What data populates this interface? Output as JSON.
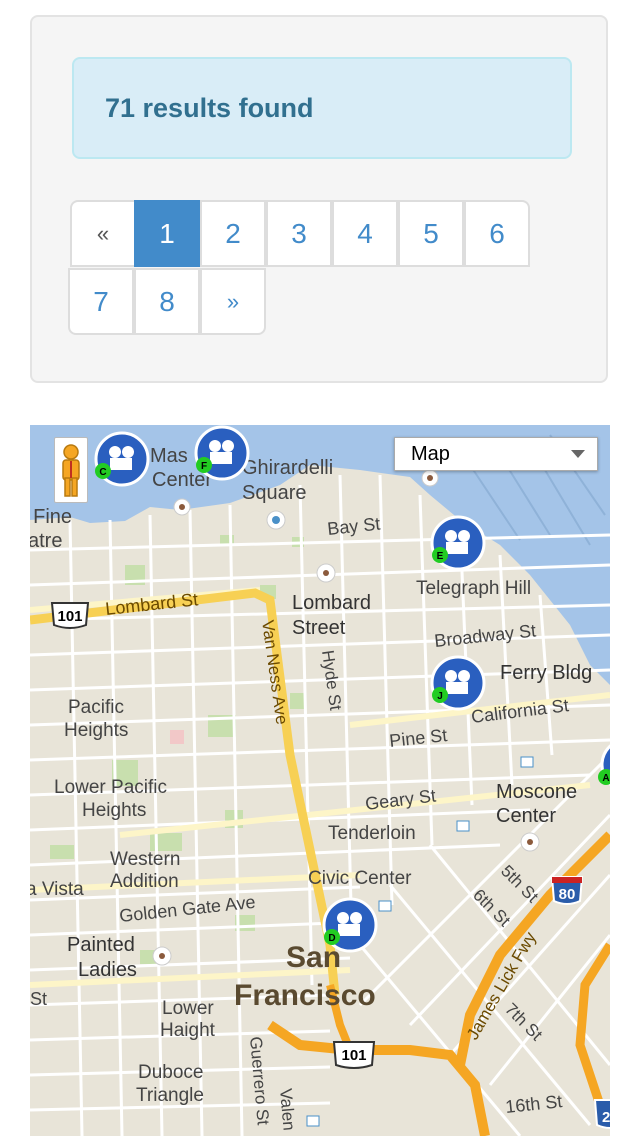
{
  "results": {
    "text": "71 results found"
  },
  "pagination": {
    "prev": "«",
    "next": "»",
    "pages": [
      "1",
      "2",
      "3",
      "4",
      "5",
      "6",
      "7",
      "8"
    ],
    "active": "1"
  },
  "map": {
    "type_selector": "Map",
    "labels": {
      "masonic_center_1": "Mas",
      "masonic_center_2": "Center",
      "ghirardelli_1": "Ghirardelli",
      "ghirardelli_2": "Square",
      "fort_mason_f": "F",
      "fine_arts_1": "f Fine",
      "fine_arts_2": "atre",
      "bay_st": "Bay St",
      "telegraph_hill": "Telegraph Hill",
      "lombard_st": "Lombard St",
      "lombard_street_1": "Lombard",
      "lombard_street_2": "Street",
      "broadway_st": "Broadway St",
      "van_ness_ave": "Van Ness Ave",
      "hyde_st": "Hyde St",
      "ferry_bldg": "Ferry Bldg",
      "california_st": "California St",
      "pacific_heights_1": "Pacific",
      "pacific_heights_2": "Heights",
      "pine_st": "Pine St",
      "lower_pacific_1": "Lower Pacific",
      "lower_pacific_2": "Heights",
      "geary_st": "Geary St",
      "moscone_1": "Moscone",
      "moscone_2": "Center",
      "tenderloin": "Tenderloin",
      "western_addition_1": "Western",
      "western_addition_2": "Addition",
      "civic_center": "Civic Center",
      "fifth_st": "5th St",
      "sixth_st": "6th St",
      "vista": "a Vista",
      "golden_gate_ave": "Golden Gate Ave",
      "painted_ladies_1": "Painted",
      "painted_ladies_2": "Ladies",
      "san": "San",
      "francisco": "Francisco",
      "james_lick": "James Lick Fwy",
      "st_left": "St",
      "lower_haight_1": "Lower",
      "lower_haight_2": "Haight",
      "seventh_st": "7th St",
      "duboce_1": "Duboce",
      "duboce_2": "Triangle",
      "guerrero": "Guerrero St",
      "valencia": "Valen",
      "sixteenth_st": "16th St",
      "shield_101_a": "101",
      "shield_101_b": "101",
      "shield_80": "80",
      "shield_2": "2"
    },
    "markers": [
      "C",
      "F",
      "E",
      "J",
      "D",
      "A"
    ]
  }
}
